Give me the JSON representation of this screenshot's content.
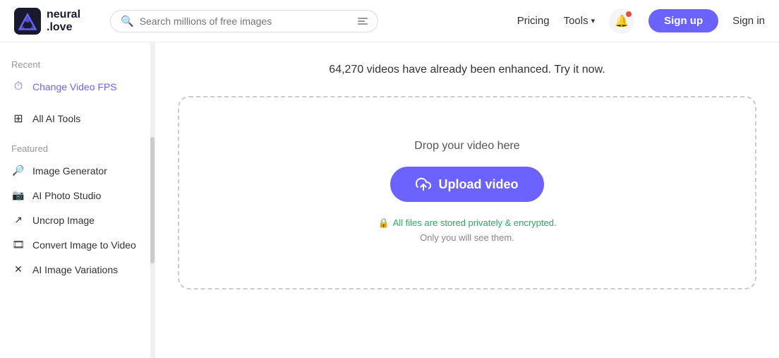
{
  "header": {
    "logo_line1": "neural",
    "logo_line2": ".love",
    "search_placeholder": "Search millions of free images",
    "pricing_label": "Pricing",
    "tools_label": "Tools",
    "signup_label": "Sign up",
    "signin_label": "Sign in"
  },
  "sidebar": {
    "recent_label": "Recent",
    "recent_item": "Change Video FPS",
    "all_tools_label": "All AI Tools",
    "featured_label": "Featured",
    "featured_items": [
      {
        "label": "Image Generator",
        "icon": "🔍"
      },
      {
        "label": "AI Photo Studio",
        "icon": "📷"
      },
      {
        "label": "Uncrop Image",
        "icon": "↗"
      },
      {
        "label": "Convert Image to Video",
        "icon": "🖼"
      },
      {
        "label": "AI Image Variations",
        "icon": "✕"
      }
    ]
  },
  "main": {
    "tagline": "64,270 videos have already been enhanced. Try it now.",
    "drop_label": "Drop your video here",
    "upload_button_label": "Upload video",
    "privacy_line1": "All files are stored privately & encrypted.",
    "privacy_line2": "Only you will see them."
  }
}
